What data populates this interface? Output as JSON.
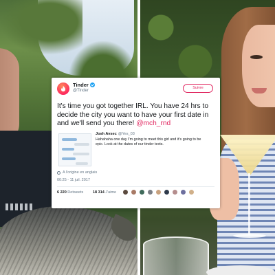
{
  "tweet": {
    "account_name": "Tinder",
    "handle": "@Tinder",
    "follow_label": "Suivre",
    "text_main": "It's time you got together IRL. You have 24 hrs to decide the city you want to have your first date in and we'll send you there! ",
    "mention": "@mch_rnd",
    "quoted": {
      "author_name": "Josh Avsec",
      "author_handle": "@Yes_03",
      "text": "Hahahaha one day I'm going to meet this girl and it's going to be epic. Look at the dates of our tinder texts."
    },
    "translate_label": "A l'origine en anglais",
    "timestamp": "00:25 - 11 juil. 2017",
    "retweets_count": "6 220",
    "retweets_label": "Retweets",
    "likes_count": "18 314",
    "likes_label": "J'aime"
  },
  "colors": {
    "brand": "#fd2a5e",
    "mention": "#e0245e",
    "verified": "#1da1f2"
  },
  "icons": {
    "avatar": "tinder-flame-icon",
    "verified": "verified-badge-icon",
    "translate": "globe-icon"
  }
}
